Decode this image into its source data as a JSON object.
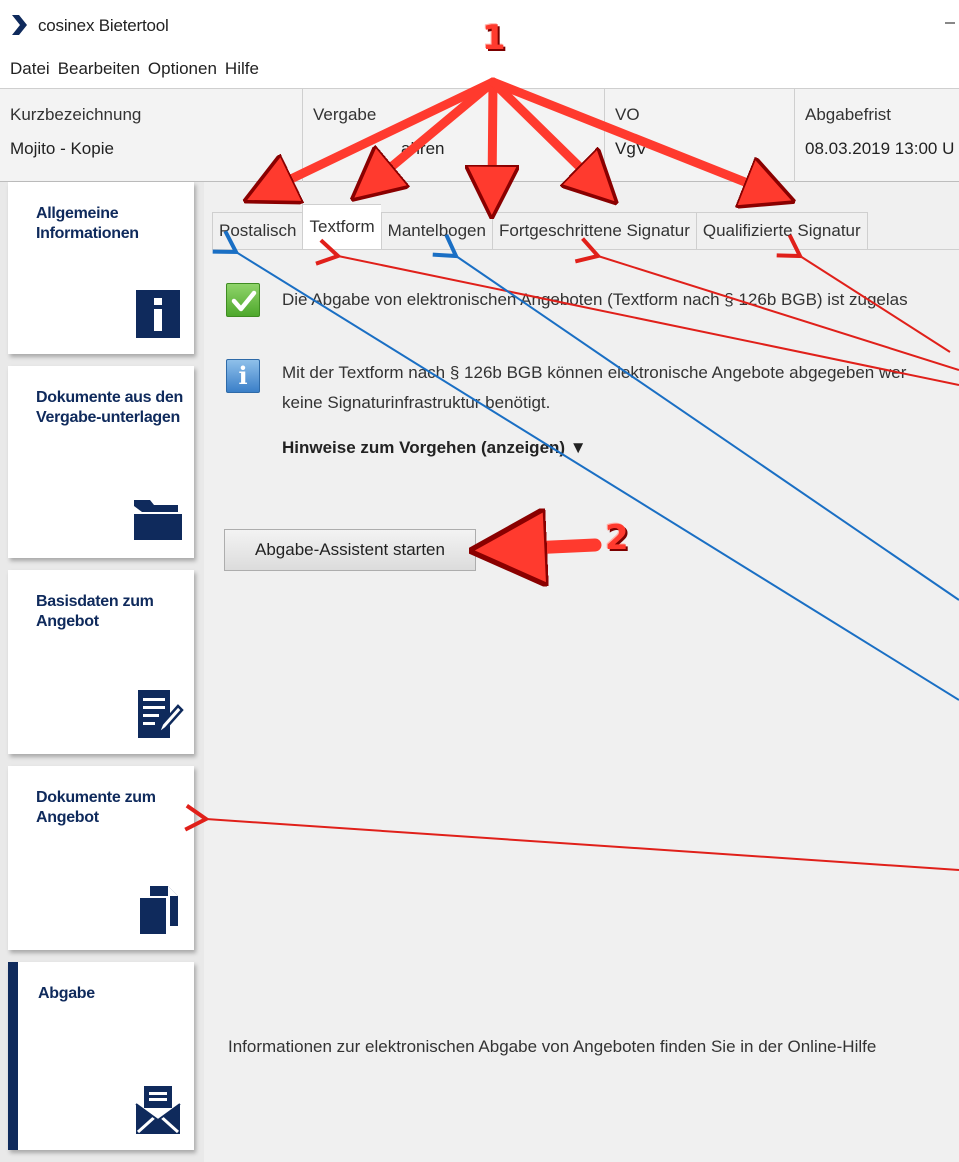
{
  "window": {
    "title": "cosinex Bietertool"
  },
  "menu": [
    "Datei",
    "Bearbeiten",
    "Optionen",
    "Hilfe"
  ],
  "info": [
    {
      "label": "Kurzbezeichnung",
      "value": "Mojito - Kopie"
    },
    {
      "label": "Vergabe",
      "value": "ahren"
    },
    {
      "label": "VO",
      "value": "VgV"
    },
    {
      "label": "Abgabefrist",
      "value": "08.03.2019 13:00 U"
    }
  ],
  "sidebar": [
    {
      "label": "Allgemeine Informationen",
      "icon": "info-icon"
    },
    {
      "label": "Dokumente aus den Vergabe-unterlagen",
      "icon": "folder-icon"
    },
    {
      "label": "Basisdaten zum Angebot",
      "icon": "edit-document-icon"
    },
    {
      "label": "Dokumente zum Angebot",
      "icon": "documents-icon"
    },
    {
      "label": "Abgabe",
      "icon": "envelope-icon"
    }
  ],
  "tabs": [
    "Postalisch",
    "Textform",
    "Mantelbogen",
    "Fortgeschrittene Signatur",
    "Qualifizierte Signatur"
  ],
  "content": {
    "allowed_msg": "Die Abgabe von elektronischen Angeboten (Textform nach § 126b BGB) ist zugelas",
    "info_line1": "Mit der Textform nach § 126b BGB können elektronische Angebote abgegeben wer",
    "info_line2": "keine Signaturinfrastruktur benötigt.",
    "hint_link": "Hinweise zum Vorgehen (anzeigen) ▼",
    "start_button": "Abgabe-Assistent starten",
    "footer": "Informationen zur elektronischen Abgabe von Angeboten finden Sie in der Online-Hilfe"
  },
  "annotations": {
    "callout_1": "1",
    "callout_2": "2"
  },
  "colors": {
    "accent": "#0f2a5c",
    "annotation_red": "#ff3a2e",
    "annotation_blue": "#1a6fc4"
  }
}
